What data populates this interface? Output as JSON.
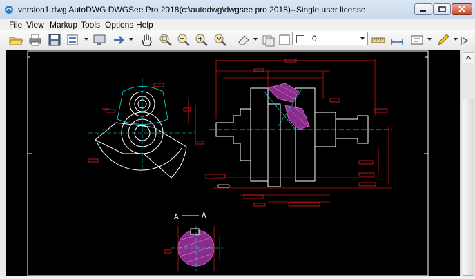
{
  "window": {
    "title": "version1.dwg AutoDWG DWGSee Pro 2018(c:\\autodwg\\dwgsee pro 2018)--Single user license"
  },
  "menu": {
    "items": [
      {
        "label": "File"
      },
      {
        "label": "View"
      },
      {
        "label": "Markup"
      },
      {
        "label": "Tools"
      },
      {
        "label": "Options"
      },
      {
        "label": "Help"
      }
    ]
  },
  "toolbar": {
    "layer_value": "0",
    "icons": [
      "open-folder-icon",
      "print-icon",
      "save-icon",
      "print-preview-icon",
      "monitor-icon",
      "arrow-icon",
      "pan-hand-icon",
      "zoom-window-icon",
      "zoom-out-icon",
      "zoom-in-icon",
      "zoom-extents-icon",
      "eraser-icon",
      "layers-icon",
      "measure-icon",
      "dimension-icon",
      "text-icon",
      "pen-icon"
    ]
  },
  "drawing": {
    "section_label_left": "A",
    "section_label_right": "A",
    "colors": {
      "background": "#000000",
      "dimension": "#ff2020",
      "geometry": "#ffffff",
      "center": "#00e5e5",
      "hatch": "#c040c0"
    }
  }
}
